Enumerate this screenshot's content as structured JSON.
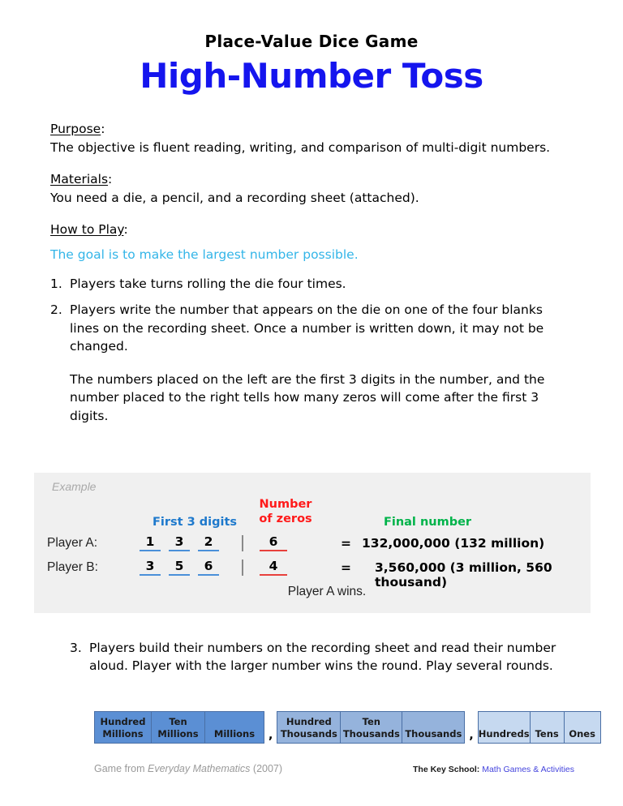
{
  "header": {
    "subtitle": "Place-Value Dice Game",
    "title": "High-Number Toss",
    "title_color": "#1515EE"
  },
  "sections": {
    "purpose": {
      "label": "Purpose",
      "colon": ":",
      "text": "The objective is fluent reading, writing, and comparison of multi-digit numbers."
    },
    "materials": {
      "label": "Materials",
      "colon": ":",
      "text": "You need a die, a pencil, and a recording sheet (attached)."
    },
    "how_to_play": {
      "label": "How to Play",
      "colon": ":",
      "goal": "The goal is to make the largest number possible.",
      "goal_color": "#33B5E8",
      "steps": [
        {
          "num": "1.",
          "text": "Players take turns rolling the die four times."
        },
        {
          "num": "2.",
          "text": "Players write the number that appears on the die on one of the four blanks lines on the recording sheet.  Once a number is written down, it may not be changed."
        },
        {
          "num": "3.",
          "text": "Players build their numbers on the recording sheet and read their number aloud.  Player with the larger number wins the round.  Play several rounds."
        }
      ],
      "step2_note": "The numbers placed on the left are the first 3 digits in the number, and the number placed to the right tells how many zeros will come after the first 3 digits."
    }
  },
  "example": {
    "label": "Example",
    "bg_color": "#F0F0F0",
    "headers": {
      "first_digits": "First 3 digits",
      "first_digits_color": "#1E79CC",
      "zeros_line1": "Number",
      "zeros_line2": "of zeros",
      "zeros_color": "#FF1A1A",
      "final": "Final number",
      "final_color": "#00B34A"
    },
    "rows": [
      {
        "player": "Player A:",
        "digits": [
          "1",
          "3",
          "2"
        ],
        "zeros": "6",
        "equals": "=",
        "final": "132,000,000 (132 million)"
      },
      {
        "player": "Player B:",
        "digits": [
          "3",
          "5",
          "6"
        ],
        "zeros": "4",
        "equals": "=",
        "final": "3,560,000 (3 million, 560 thousand)"
      }
    ],
    "winner": "Player A wins."
  },
  "place_value_table": {
    "groups": [
      {
        "color": "#5B8FD4",
        "cells": [
          {
            "line1": "Hundred",
            "line2": "Millions"
          },
          {
            "line1": "Ten",
            "line2": "Millions"
          },
          {
            "line1": "",
            "line2": "Millions"
          }
        ]
      },
      {
        "color": "#95B3DC",
        "cells": [
          {
            "line1": "Hundred",
            "line2": "Thousands"
          },
          {
            "line1": "Ten",
            "line2": "Thousands"
          },
          {
            "line1": "",
            "line2": "Thousands"
          }
        ]
      },
      {
        "color": "#C6D9F0",
        "cells": [
          {
            "line1": "",
            "line2": "Hundreds"
          },
          {
            "line1": "",
            "line2": "Tens"
          },
          {
            "line1": "",
            "line2": "Ones"
          }
        ]
      }
    ],
    "separators": [
      ",",
      ","
    ]
  },
  "footer": {
    "left_prefix": "Game from ",
    "left_italic": "Everyday Mathematics",
    "left_suffix": " (2007)",
    "right_prefix": "The Key School: ",
    "right_link": "Math Games & Activities",
    "right_link_color": "#4444DD"
  }
}
